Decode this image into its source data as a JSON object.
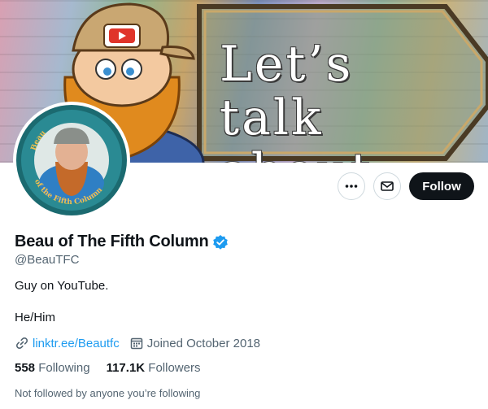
{
  "banner": {
    "text": "Let’s talk about..."
  },
  "profile": {
    "display_name": "Beau of The Fifth Column",
    "handle": "@BeauTFC",
    "bio_line1": "Guy on YouTube.",
    "bio_line2": "He/Him",
    "link": "linktr.ee/Beautfc",
    "joined": "Joined October 2018",
    "following_count": "558",
    "following_label": "Following",
    "followers_count": "117.1K",
    "followers_label": "Followers",
    "followed_by": "Not followed by anyone you’re following",
    "avatar_ring_top": "Beau",
    "avatar_ring_bottom": "of the Fifth Column"
  },
  "actions": {
    "more_icon": "more-icon",
    "message_icon": "envelope-icon",
    "follow_label": "Follow"
  },
  "colors": {
    "accent": "#1d9bf0",
    "text": "#0f1419",
    "secondary": "#536471",
    "button_dark": "#0f1419"
  }
}
